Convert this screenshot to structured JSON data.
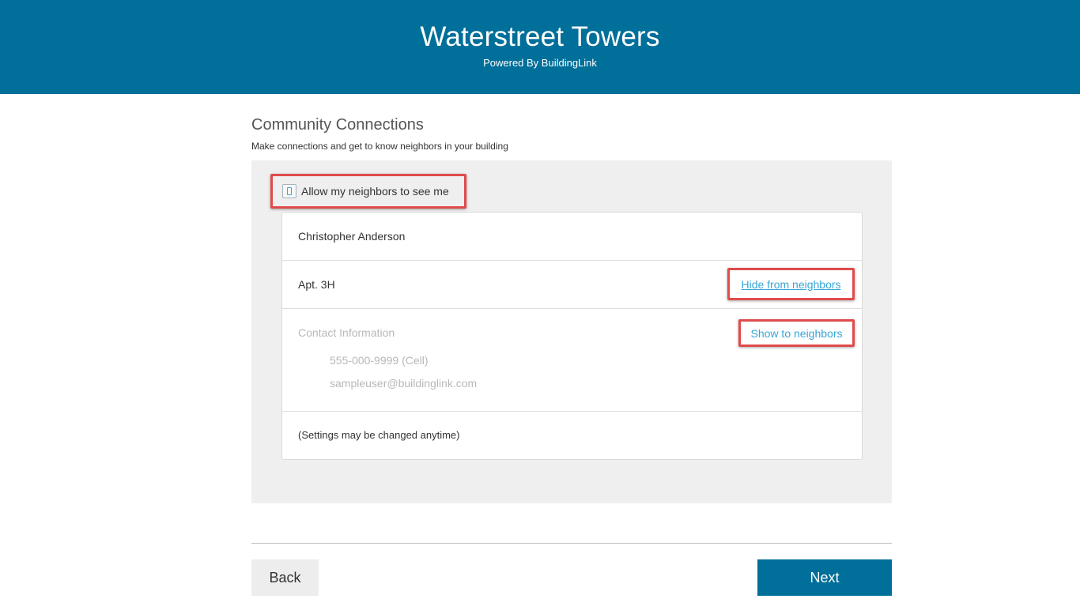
{
  "header": {
    "title": "Waterstreet Towers",
    "subtitle": "Powered By BuildingLink",
    "background_color": "#006f9a"
  },
  "section": {
    "title": "Community Connections",
    "description": "Make connections and get to know neighbors in your building"
  },
  "visibility": {
    "checkbox_label": "Allow my neighbors to see me",
    "checked": false
  },
  "profile": {
    "name": "Christopher Anderson",
    "apartment": "Apt. 3H",
    "hide_link": "Hide from neighbors",
    "contact_heading": "Contact Information",
    "show_link": "Show to neighbors",
    "phone": "555-000-9999 (Cell)",
    "email": "sampleuser@buildinglink.com",
    "note": "(Settings may be changed anytime)"
  },
  "footer": {
    "back_label": "Back",
    "next_label": "Next"
  },
  "colors": {
    "brand": "#006f9a",
    "link": "#37a6d6",
    "highlight": "#e04b4b",
    "panel": "#efefef"
  }
}
